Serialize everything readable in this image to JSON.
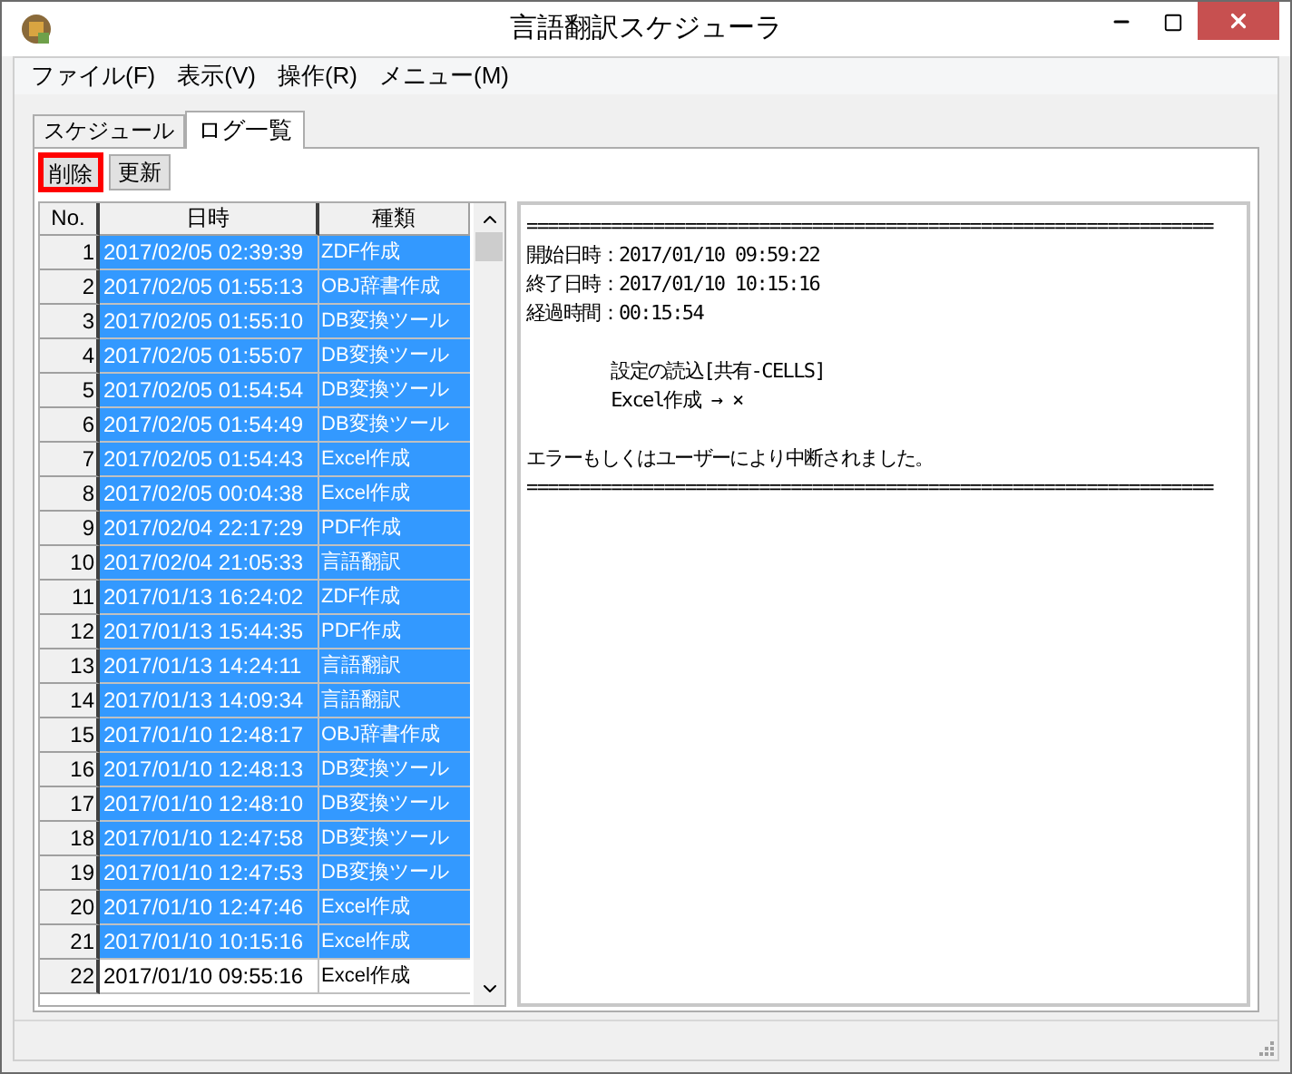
{
  "window": {
    "title": "言語翻訳スケジューラ"
  },
  "menu": [
    "ファイル(F)",
    "表示(V)",
    "操作(R)",
    "メニュー(M)"
  ],
  "tabs": [
    {
      "label": "スケジュール",
      "selected": false
    },
    {
      "label": "ログ一覧",
      "selected": true
    }
  ],
  "toolbar": [
    {
      "label": "削除",
      "highlighted": true
    },
    {
      "label": "更新",
      "highlighted": false
    }
  ],
  "table": {
    "columns": [
      "No.",
      "日時",
      "種類"
    ],
    "rows": [
      {
        "no": "1",
        "datetime": "2017/02/05 02:39:39",
        "type": "ZDF作成",
        "selected": true
      },
      {
        "no": "2",
        "datetime": "2017/02/05 01:55:13",
        "type": "OBJ辞書作成",
        "selected": true
      },
      {
        "no": "3",
        "datetime": "2017/02/05 01:55:10",
        "type": "DB変換ツール",
        "selected": true
      },
      {
        "no": "4",
        "datetime": "2017/02/05 01:55:07",
        "type": "DB変換ツール",
        "selected": true
      },
      {
        "no": "5",
        "datetime": "2017/02/05 01:54:54",
        "type": "DB変換ツール",
        "selected": true
      },
      {
        "no": "6",
        "datetime": "2017/02/05 01:54:49",
        "type": "DB変換ツール",
        "selected": true
      },
      {
        "no": "7",
        "datetime": "2017/02/05 01:54:43",
        "type": "Excel作成",
        "selected": true
      },
      {
        "no": "8",
        "datetime": "2017/02/05 00:04:38",
        "type": "Excel作成",
        "selected": true
      },
      {
        "no": "9",
        "datetime": "2017/02/04 22:17:29",
        "type": "PDF作成",
        "selected": true
      },
      {
        "no": "10",
        "datetime": "2017/02/04 21:05:33",
        "type": "言語翻訳",
        "selected": true
      },
      {
        "no": "11",
        "datetime": "2017/01/13 16:24:02",
        "type": "ZDF作成",
        "selected": true
      },
      {
        "no": "12",
        "datetime": "2017/01/13 15:44:35",
        "type": "PDF作成",
        "selected": true
      },
      {
        "no": "13",
        "datetime": "2017/01/13 14:24:11",
        "type": "言語翻訳",
        "selected": true
      },
      {
        "no": "14",
        "datetime": "2017/01/13 14:09:34",
        "type": "言語翻訳",
        "selected": true
      },
      {
        "no": "15",
        "datetime": "2017/01/10 12:48:17",
        "type": "OBJ辞書作成",
        "selected": true
      },
      {
        "no": "16",
        "datetime": "2017/01/10 12:48:13",
        "type": "DB変換ツール",
        "selected": true
      },
      {
        "no": "17",
        "datetime": "2017/01/10 12:48:10",
        "type": "DB変換ツール",
        "selected": true
      },
      {
        "no": "18",
        "datetime": "2017/01/10 12:47:58",
        "type": "DB変換ツール",
        "selected": true
      },
      {
        "no": "19",
        "datetime": "2017/01/10 12:47:53",
        "type": "DB変換ツール",
        "selected": true
      },
      {
        "no": "20",
        "datetime": "2017/01/10 12:47:46",
        "type": "Excel作成",
        "selected": true
      },
      {
        "no": "21",
        "datetime": "2017/01/10 10:15:16",
        "type": "Excel作成",
        "selected": true
      },
      {
        "no": "22",
        "datetime": "2017/01/10 09:55:16",
        "type": "Excel作成",
        "selected": false
      }
    ]
  },
  "log": {
    "blocks": [
      [
        "=================================================================",
        "開始日時：2017/01/10 09:59:22",
        "終了日時：2017/01/10 10:15:16",
        "経過時間：00:15:54"
      ],
      [
        "        設定の読込[共有-CELLS]",
        "        Excel作成 → ×"
      ],
      [
        "エラーもしくはユーザーにより中断されました。",
        "================================================================="
      ]
    ]
  }
}
